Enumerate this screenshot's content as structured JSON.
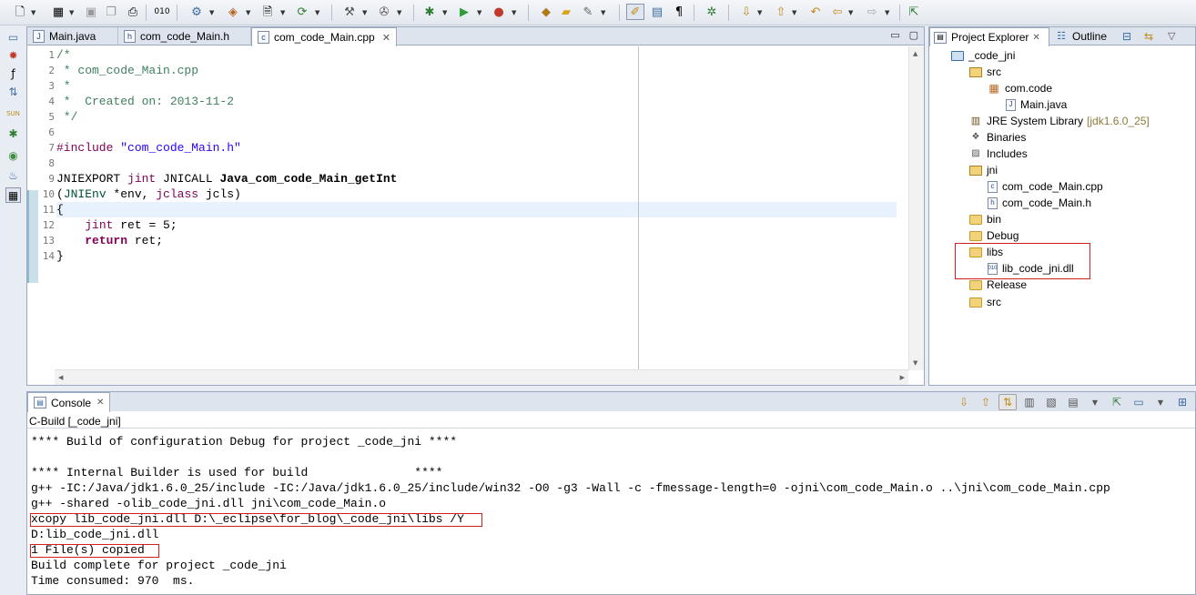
{
  "toolbar": {
    "icons": [
      "new-wizard",
      "new",
      "save",
      "save-all",
      "print",
      "binary",
      "build-all",
      "new-cpp-class",
      "new-source",
      "new-project",
      "build",
      "tools",
      "debug",
      "run",
      "run-external",
      "open-type",
      "open-folder",
      "search",
      "toggle-mark",
      "toggle-block",
      "show-whitespace",
      "step-filter",
      "next-annotation",
      "prev-annotation",
      "last-edit",
      "back",
      "forward",
      "pin"
    ]
  },
  "editor": {
    "tabs": [
      {
        "label": "Main.java",
        "icon": "J"
      },
      {
        "label": "com_code_Main.h",
        "icon": "h"
      },
      {
        "label": "com_code_Main.cpp",
        "icon": "c"
      }
    ],
    "minimize": "▭",
    "maximize": "▢",
    "line_numbers": [
      "1",
      "2",
      "3",
      "4",
      "5",
      "6",
      "7",
      "8",
      "9",
      "10",
      "11",
      "12",
      "13",
      "14"
    ],
    "lines": [
      {
        "t": "/*"
      },
      {
        "t": " * com_code_Main.cpp"
      },
      {
        "t": " *"
      },
      {
        "t": " *  Created on: 2013-11-2"
      },
      {
        "t": " */"
      },
      {
        "t": ""
      },
      {
        "a": "#include ",
        "b": "\"com_code_Main.h\""
      },
      {
        "t": ""
      },
      {
        "a": "JNIEXPORT ",
        "b": "jint",
        "c": " JNICALL ",
        "d": "Java_com_code_Main_getInt"
      },
      {
        "a": "(",
        "b": "JNIEnv",
        "c": " *env, ",
        "d": "jclass",
        "e": " jcls)"
      },
      {
        "t": "{"
      },
      {
        "a": "    ",
        "b": "jint",
        "c": " ret = 5;"
      },
      {
        "a": "    ",
        "b": "return",
        "c": " ret;"
      },
      {
        "t": "}"
      }
    ]
  },
  "explorer": {
    "tabs": [
      {
        "label": "Project Explorer",
        "close": "✕"
      },
      {
        "label": "Outline"
      }
    ],
    "tree": [
      {
        "label": "_code_jni"
      },
      {
        "label": "src"
      },
      {
        "label": "com.code"
      },
      {
        "label": "Main.java"
      },
      {
        "label": "JRE System Library",
        "extra": "[jdk1.6.0_25]"
      },
      {
        "label": "Binaries"
      },
      {
        "label": "Includes"
      },
      {
        "label": "jni"
      },
      {
        "label": "com_code_Main.cpp"
      },
      {
        "label": "com_code_Main.h"
      },
      {
        "label": "bin"
      },
      {
        "label": "Debug"
      },
      {
        "label": "libs"
      },
      {
        "label": "lib_code_jni.dll"
      },
      {
        "label": "Release"
      },
      {
        "label": "src"
      }
    ]
  },
  "console": {
    "tab_label": "Console",
    "close": "✕",
    "description": "C-Build [_code_jni]",
    "lines": [
      "**** Build of configuration Debug for project _code_jni ****",
      "",
      "**** Internal Builder is used for build               ****",
      "g++ -IC:/Java/jdk1.6.0_25/include -IC:/Java/jdk1.6.0_25/include/win32 -O0 -g3 -Wall -c -fmessage-length=0 -ojni\\com_code_Main.o ..\\jni\\com_code_Main.cpp",
      "g++ -shared -olib_code_jni.dll jni\\com_code_Main.o",
      "xcopy lib_code_jni.dll D:\\_eclipse\\for_blog\\_code_jni\\libs /Y",
      "D:lib_code_jni.dll",
      "1 File(s) copied",
      "Build complete for project _code_jni",
      "Time consumed: 970  ms."
    ]
  }
}
